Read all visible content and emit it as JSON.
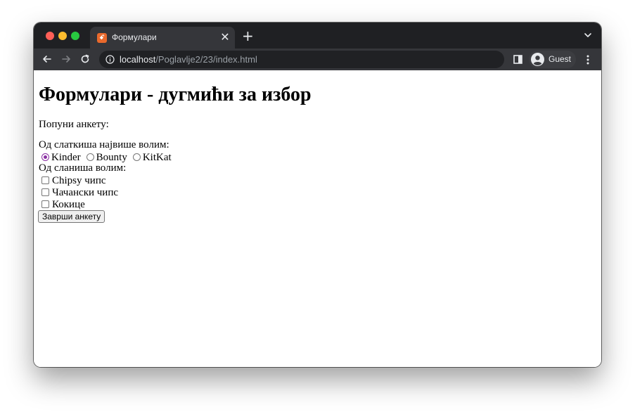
{
  "browser": {
    "tab": {
      "title": "Формулари",
      "favicon": "xampp-favicon-icon",
      "close_glyph": "✕"
    },
    "new_tab_glyph": "+",
    "address_bar": {
      "host": "localhost",
      "path": "/Poglavlje2/23/index.html"
    },
    "profile": {
      "label": "Guest"
    },
    "colors": {
      "frame": "#1f2023",
      "toolbar": "#35363a",
      "accent": "#8a2fa3"
    }
  },
  "page": {
    "title": "Формулари - дугмићи за избор",
    "intro": "Попуни анкету:",
    "sweets_question": "Од слаткиша највише волим:",
    "sweets_options": [
      {
        "label": "Kinder",
        "checked": true
      },
      {
        "label": "Bounty",
        "checked": false
      },
      {
        "label": "KitKat",
        "checked": false
      }
    ],
    "snacks_question": "Од сланиша волим:",
    "snacks_options": [
      {
        "label": "Chipsy чипс",
        "checked": false
      },
      {
        "label": "Чачански чипс",
        "checked": false
      },
      {
        "label": "Кокице",
        "checked": false
      }
    ],
    "submit_label": "Заврши анкету"
  }
}
